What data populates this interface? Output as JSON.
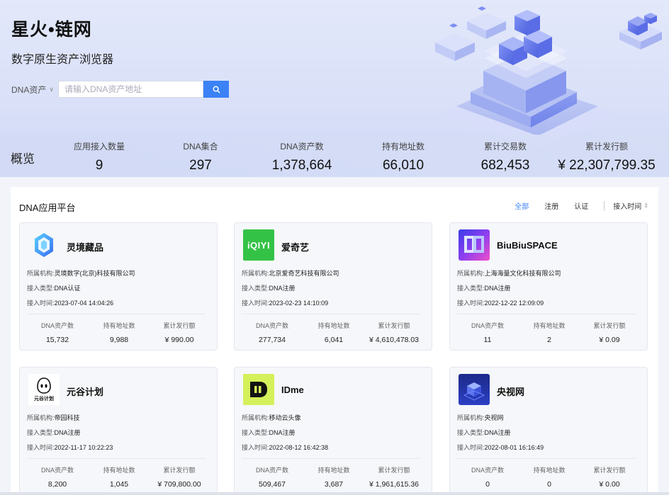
{
  "hero": {
    "title": "星火•链网",
    "subtitle": "数字原生资产浏览器",
    "search": {
      "select_label": "DNA资产",
      "placeholder": "请输入DNA资产地址",
      "value": ""
    }
  },
  "overview": {
    "label": "概览",
    "stats": [
      {
        "label": "应用接入数量",
        "value": "9"
      },
      {
        "label": "DNA集合",
        "value": "297"
      },
      {
        "label": "DNA资产数",
        "value": "1,378,664"
      },
      {
        "label": "持有地址数",
        "value": "66,010"
      },
      {
        "label": "累计交易数",
        "value": "682,453"
      },
      {
        "label": "累计发行额",
        "value": "¥ 22,307,799.35"
      }
    ]
  },
  "platform": {
    "title": "DNA应用平台",
    "filters": {
      "all": "全部",
      "register": "注册",
      "certify": "认证",
      "sort": "接入时间"
    },
    "field_labels": {
      "org": "所属机构:",
      "type": "接入类型:",
      "time": "接入时间:"
    },
    "metric_labels": {
      "assets": "DNA资产数",
      "holders": "持有地址数",
      "issued": "累计发行额"
    },
    "cards": [
      {
        "name": "灵境藏品",
        "logo_icon": "lingjing-crystal-logo",
        "org": "灵境数字(北京)科技有限公司",
        "type": "DNA认证",
        "time": "2023-07-04 14:04:26",
        "assets": "15,732",
        "holders": "9,988",
        "issued": "¥ 990.00"
      },
      {
        "name": "爱奇艺",
        "logo_icon": "iqiyi-logo",
        "logo_text": "iQIYI",
        "org": "北京爱奇艺科技有限公司",
        "type": "DNA注册",
        "time": "2023-02-23 14:10:09",
        "assets": "277,734",
        "holders": "6,041",
        "issued": "¥ 4,610,478.03"
      },
      {
        "name": "BiuBiuSPACE",
        "logo_icon": "biubiu-space-logo",
        "org": "上海海量文化科技有限公司",
        "type": "DNA注册",
        "time": "2022-12-22 12:09:09",
        "assets": "11",
        "holders": "2",
        "issued": "¥ 0.09"
      },
      {
        "name": "元谷计划",
        "logo_icon": "yuangu-ghost-logo",
        "logo_text": "元谷计划",
        "org": "帝园科技",
        "type": "DNA注册",
        "time": "2022-11-17 10:22:23",
        "assets": "8,200",
        "holders": "1,045",
        "issued": "¥ 709,800.00"
      },
      {
        "name": "IDme",
        "logo_icon": "idme-logo",
        "org": "移动云头像",
        "type": "DNA注册",
        "time": "2022-08-12 16:42:38",
        "assets": "509,467",
        "holders": "3,687",
        "issued": "¥ 1,961,615.36"
      },
      {
        "name": "央视网",
        "logo_icon": "cctv-cube-logo",
        "org": "央视网",
        "type": "DNA注册",
        "time": "2022-08-01 16:16:49",
        "assets": "0",
        "holders": "0",
        "issued": "¥ 0.00"
      }
    ]
  },
  "colors": {
    "accent": "#3b82f6",
    "iqiyi": "#34c246",
    "idme": "#d4f05a"
  }
}
